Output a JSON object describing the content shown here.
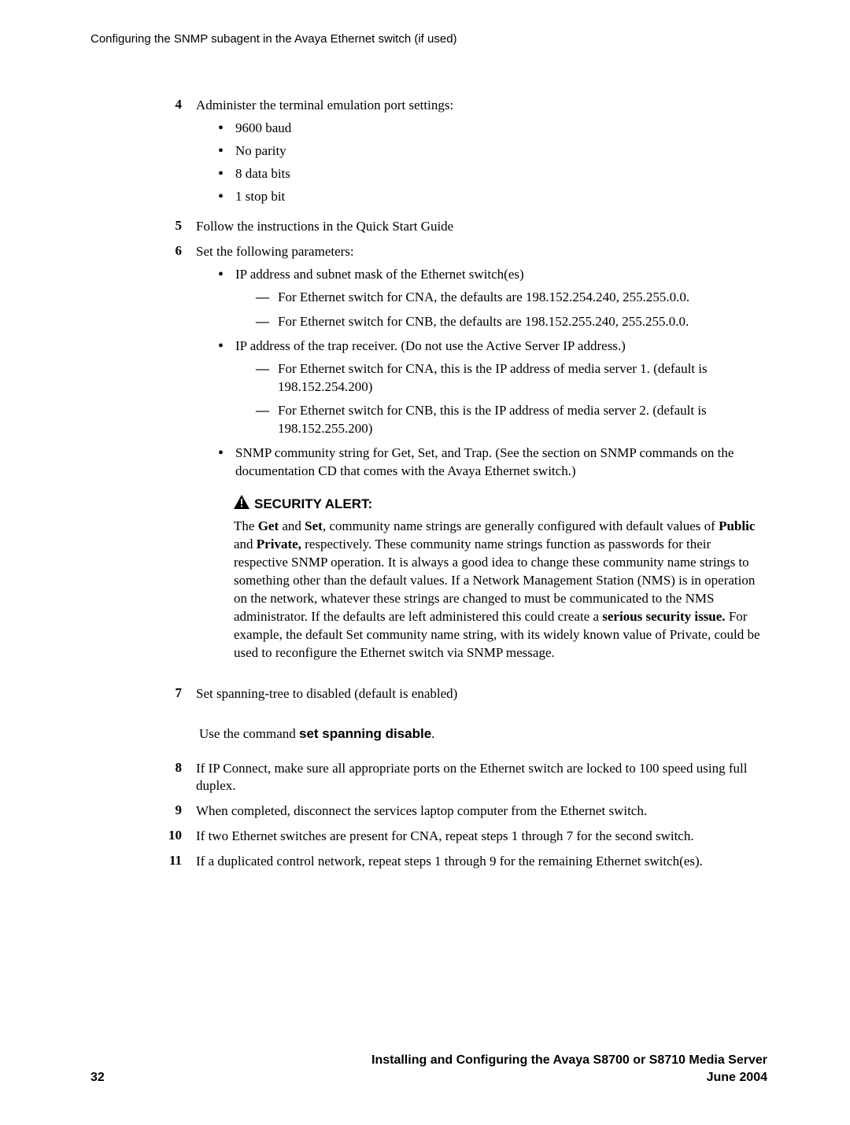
{
  "header": "Configuring the SNMP subagent in the Avaya Ethernet switch (if used)",
  "steps": {
    "s4": {
      "text": "Administer the terminal emulation port settings:",
      "bullets": [
        "9600 baud",
        "No parity",
        "8 data bits",
        "1 stop bit"
      ]
    },
    "s5": {
      "text": "Follow the instructions in the Quick Start Guide"
    },
    "s6": {
      "text": "Set the following parameters:",
      "b1": {
        "text": "IP address and subnet mask of the Ethernet switch(es)",
        "d1": "For Ethernet switch for CNA, the defaults are 198.152.254.240, 255.255.0.0.",
        "d2": "For Ethernet switch for CNB, the defaults are 198.152.255.240, 255.255.0.0."
      },
      "b2": {
        "text": "IP address of the trap receiver. (Do not use the Active Server IP address.)",
        "d1": "For Ethernet switch for CNA, this is the IP address of media server 1. (default is 198.152.254.200)",
        "d2": "For Ethernet switch for CNB, this is the IP address of media server 2. (default is 198.152.255.200)"
      },
      "b3": "SNMP community string for Get, Set, and Trap. (See the section on SNMP commands on the documentation CD that comes with the Avaya Ethernet switch.)"
    },
    "alert": {
      "title": "SECURITY ALERT:",
      "pre1": "The ",
      "bold1": "Get",
      "mid1": " and ",
      "bold2": "Set",
      "post1": ", community name strings are generally configured with default values of ",
      "bold3": "Public",
      "mid2": " and ",
      "bold4": "Private,",
      "post2": " respectively. These community name strings function as passwords for their respective SNMP operation. It is always a good idea to change these community name strings to something other than the default values. If a Network Management Station (NMS) is in operation on the network, whatever these strings are changed to must be communicated to the NMS administrator. If the defaults are left administered this could create a ",
      "bold5": "serious security issue.",
      "post3": " For example, the default Set community name string, with its widely known value of Private, could be used to reconfigure the Ethernet switch via SNMP message."
    },
    "s7": {
      "text": "Set spanning-tree to disabled (default is enabled)",
      "sub_pre": "Use the command ",
      "sub_bold": "set spanning disable",
      "sub_post": "."
    },
    "s8": {
      "text": "If IP Connect, make sure all appropriate ports on the Ethernet switch are locked to 100 speed using full duplex."
    },
    "s9": {
      "text": "When completed, disconnect the services laptop computer from the Ethernet switch."
    },
    "s10": {
      "text": "If two Ethernet switches are present for CNA, repeat steps 1 through 7 for the second switch."
    },
    "s11": {
      "text": "If a duplicated control network, repeat steps 1 through 9 for the remaining Ethernet switch(es)."
    }
  },
  "footer": {
    "page": "32",
    "title": "Installing and Configuring the Avaya S8700 or S8710 Media Server",
    "date": "June 2004"
  }
}
